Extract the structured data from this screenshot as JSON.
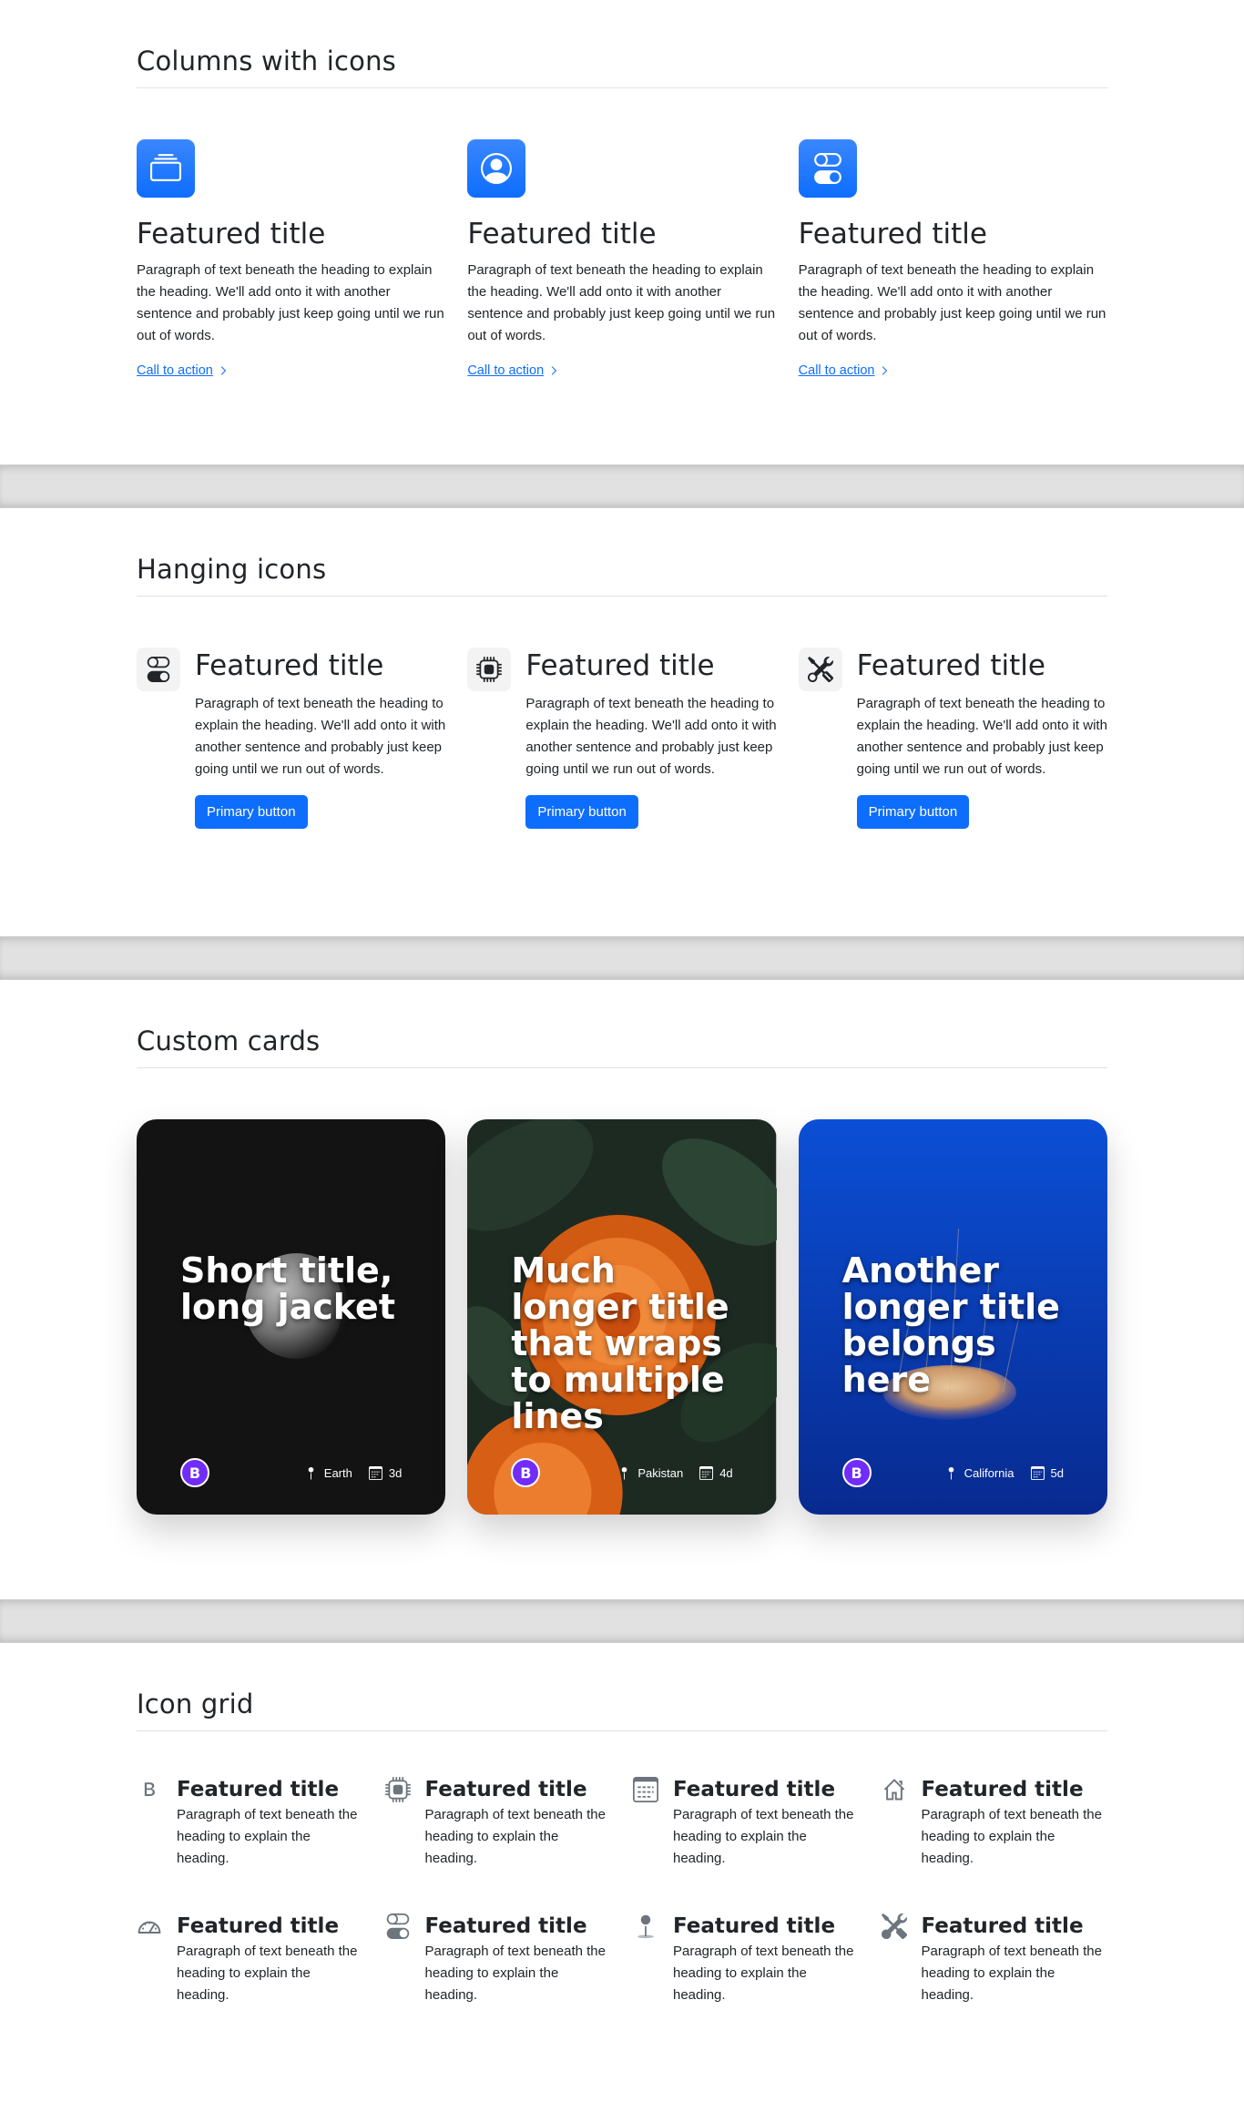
{
  "s1": {
    "title": "Columns with icons",
    "items": [
      {
        "icon": "collection-icon",
        "title": "Featured title",
        "text": "Paragraph of text beneath the heading to explain the heading. We'll add onto it with another sentence and probably just keep going until we run out of words.",
        "cta": "Call to action"
      },
      {
        "icon": "person-circle-icon",
        "title": "Featured title",
        "text": "Paragraph of text beneath the heading to explain the heading. We'll add onto it with another sentence and probably just keep going until we run out of words.",
        "cta": "Call to action"
      },
      {
        "icon": "toggles-icon",
        "title": "Featured title",
        "text": "Paragraph of text beneath the heading to explain the heading. We'll add onto it with another sentence and probably just keep going until we run out of words.",
        "cta": "Call to action"
      }
    ]
  },
  "s2": {
    "title": "Hanging icons",
    "items": [
      {
        "icon": "toggles-icon",
        "title": "Featured title",
        "text": "Paragraph of text beneath the heading to explain the heading. We'll add onto it with another sentence and probably just keep going until we run out of words.",
        "button": "Primary button"
      },
      {
        "icon": "cpu-icon",
        "title": "Featured title",
        "text": "Paragraph of text beneath the heading to explain the heading. We'll add onto it with another sentence and probably just keep going until we run out of words.",
        "button": "Primary button"
      },
      {
        "icon": "tools-icon",
        "title": "Featured title",
        "text": "Paragraph of text beneath the heading to explain the heading. We'll add onto it with another sentence and probably just keep going until we run out of words.",
        "button": "Primary button"
      }
    ]
  },
  "s3": {
    "title": "Custom cards",
    "cards": [
      {
        "title": "Short title, long jacket",
        "location": "Earth",
        "date": "3d",
        "logo": "B"
      },
      {
        "title": "Much longer title that wraps to multiple lines",
        "location": "Pakistan",
        "date": "4d",
        "logo": "B"
      },
      {
        "title": "Another longer title belongs here",
        "location": "California",
        "date": "5d",
        "logo": "B"
      }
    ]
  },
  "s4": {
    "title": "Icon grid",
    "items": [
      {
        "icon": "bootstrap-icon",
        "title": "Featured title",
        "text": "Paragraph of text beneath the heading to explain the heading."
      },
      {
        "icon": "cpu-icon",
        "title": "Featured title",
        "text": "Paragraph of text beneath the heading to explain the heading."
      },
      {
        "icon": "calendar-icon",
        "title": "Featured title",
        "text": "Paragraph of text beneath the heading to explain the heading."
      },
      {
        "icon": "house-icon",
        "title": "Featured title",
        "text": "Paragraph of text beneath the heading to explain the heading."
      },
      {
        "icon": "speedometer-icon",
        "title": "Featured title",
        "text": "Paragraph of text beneath the heading to explain the heading."
      },
      {
        "icon": "toggles-icon",
        "title": "Featured title",
        "text": "Paragraph of text beneath the heading to explain the heading."
      },
      {
        "icon": "geo-pin-icon",
        "title": "Featured title",
        "text": "Paragraph of text beneath the heading to explain the heading."
      },
      {
        "icon": "tools-icon",
        "title": "Featured title",
        "text": "Paragraph of text beneath the heading to explain the heading."
      }
    ]
  },
  "colors": {
    "primary": "#0d6efd",
    "logo_purple": "#712cf9",
    "divider": "#e1e1e1"
  }
}
